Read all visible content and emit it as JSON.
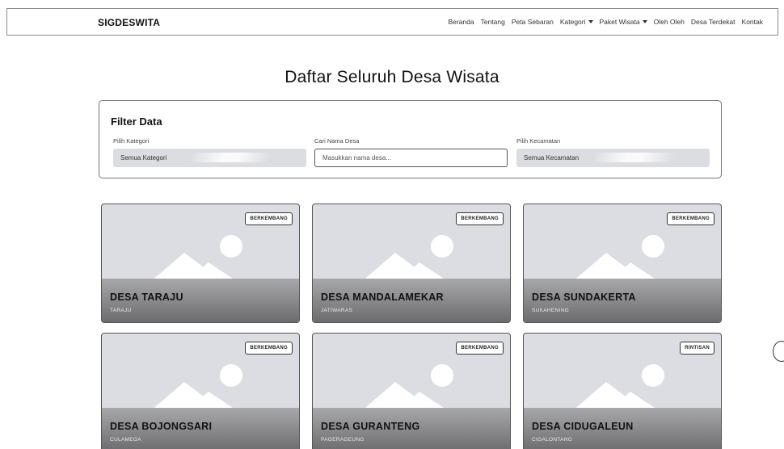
{
  "navbar": {
    "brand": "SIGDESWITA",
    "links": [
      {
        "label": "Beranda",
        "dropdown": false
      },
      {
        "label": "Tentang",
        "dropdown": false
      },
      {
        "label": "Peta Sebaran",
        "dropdown": false
      },
      {
        "label": "Kategori",
        "dropdown": true
      },
      {
        "label": "Paket Wisata",
        "dropdown": true
      },
      {
        "label": "Oleh Oleh",
        "dropdown": false
      },
      {
        "label": "Desa Terdekat",
        "dropdown": false
      },
      {
        "label": "Kontak",
        "dropdown": false
      }
    ]
  },
  "page_title": "Daftar Seluruh Desa Wisata",
  "filter": {
    "title": "Filter Data",
    "category_label": "Pilih Kategori",
    "category_value": "Semua Kategori",
    "search_label": "Cari Nama Desa",
    "search_placeholder": "Masukkan nama desa...",
    "district_label": "Pilih Kecamatan",
    "district_value": "Semua Kecamatan"
  },
  "villages": [
    {
      "name": "DESA TARAJU",
      "district": "TARAJU",
      "status": "BERKEMBANG"
    },
    {
      "name": "DESA MANDALAMEKAR",
      "district": "JATIWARAS",
      "status": "BERKEMBANG"
    },
    {
      "name": "DESA SUNDAKERTA",
      "district": "SUKAHENING",
      "status": "BERKEMBANG"
    },
    {
      "name": "DESA BOJONGSARI",
      "district": "CULAMEGA",
      "status": "BERKEMBANG"
    },
    {
      "name": "DESA GURANTENG",
      "district": "PAGERAGEUNG",
      "status": "BERKEMBANG"
    },
    {
      "name": "DESA CIDUGALEUN",
      "district": "CIGALONTANG",
      "status": "RINTISAN"
    }
  ],
  "icons": {
    "card_image": "image-placeholder-icon",
    "dropdown": "chevron-down-icon"
  },
  "colors": {
    "card_background": "#dcdde2",
    "card_overlay": "#6c6c6e",
    "select_background": "#dcdde2"
  }
}
